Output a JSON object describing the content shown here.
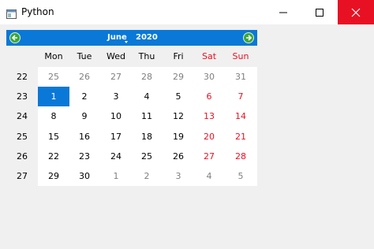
{
  "window": {
    "title": "Python"
  },
  "calendar": {
    "month": "June",
    "year": "2020",
    "weekdays": [
      "Mon",
      "Tue",
      "Wed",
      "Thu",
      "Fri",
      "Sat",
      "Sun"
    ],
    "weeks": [
      {
        "num": "22",
        "days": [
          "25",
          "26",
          "27",
          "28",
          "29",
          "30",
          "31"
        ]
      },
      {
        "num": "23",
        "days": [
          "1",
          "2",
          "3",
          "4",
          "5",
          "6",
          "7"
        ]
      },
      {
        "num": "24",
        "days": [
          "8",
          "9",
          "10",
          "11",
          "12",
          "13",
          "14"
        ]
      },
      {
        "num": "25",
        "days": [
          "15",
          "16",
          "17",
          "18",
          "19",
          "20",
          "21"
        ]
      },
      {
        "num": "26",
        "days": [
          "22",
          "23",
          "24",
          "25",
          "26",
          "27",
          "28"
        ]
      },
      {
        "num": "27",
        "days": [
          "29",
          "30",
          "1",
          "2",
          "3",
          "4",
          "5"
        ]
      }
    ],
    "selected_day": "1",
    "colors": {
      "header_bg": "#0a78d7",
      "weekend": "#e81123",
      "other_month": "#808080",
      "selected_bg": "#0a78d7",
      "close_btn": "#e81123"
    }
  }
}
